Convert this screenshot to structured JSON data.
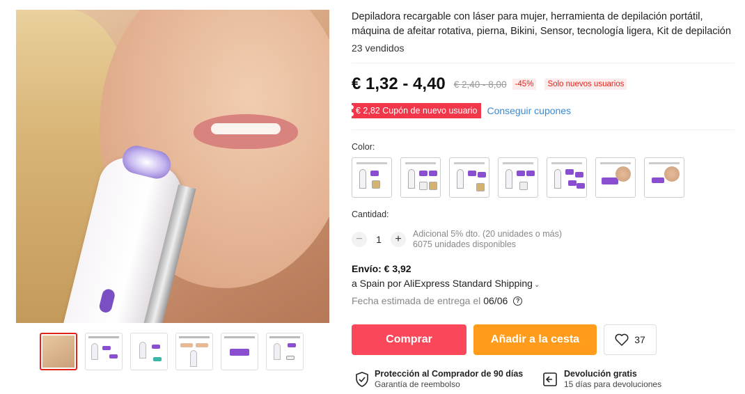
{
  "product": {
    "title": "Depiladora recargable con láser para mujer, herramienta de depilación portátil, máquina de afeitar rotativa, pierna, Bikini, Sensor, tecnología ligera, Kit de depilación",
    "sold": "23 vendidos"
  },
  "gallery": {
    "main_image": "woman-using-epilator-photo",
    "thumbnails": [
      "thumb-1",
      "thumb-2",
      "thumb-3",
      "thumb-4",
      "thumb-5",
      "thumb-6"
    ],
    "active_thumbnail_index": 0
  },
  "pricing": {
    "price": "€ 1,32 - 4,40",
    "original_price": "€ 2,40 - 8,00",
    "discount": "-45%",
    "new_users_tag": "Solo nuevos usuarios",
    "coupon": "€ 2,82 Cupón de nuevo usuario",
    "get_coupons": "Conseguir cupones"
  },
  "options": {
    "color_label": "Color:",
    "color_count": 7,
    "quantity_label": "Cantidad:",
    "quantity_value": "1",
    "minus": "−",
    "plus": "+",
    "bulk_discount": "Adicional 5% dto. (20 unidades o más)",
    "stock": "6075 unidades disponibles"
  },
  "shipping": {
    "cost": "Envío: € 3,92",
    "method": "a Spain por AliExpress Standard Shipping",
    "delivery_label": "Fecha estimada de entrega el",
    "delivery_date": "06/06",
    "help": "?"
  },
  "actions": {
    "buy": "Comprar",
    "add_to_cart": "Añadir a la cesta",
    "wishlist_count": "37"
  },
  "guarantees": {
    "protection_title": "Protección al Comprador de 90 días",
    "protection_sub": "Garantía de reembolso",
    "return_title": "Devolución gratis",
    "return_sub": "15 días para devoluciones"
  },
  "colors": {
    "price_red": "#e2231a",
    "buy_button": "#fa4759",
    "cart_button": "#ff9c1b",
    "link_blue": "#3a8ad6",
    "device_purple": "#8a4fd1"
  }
}
